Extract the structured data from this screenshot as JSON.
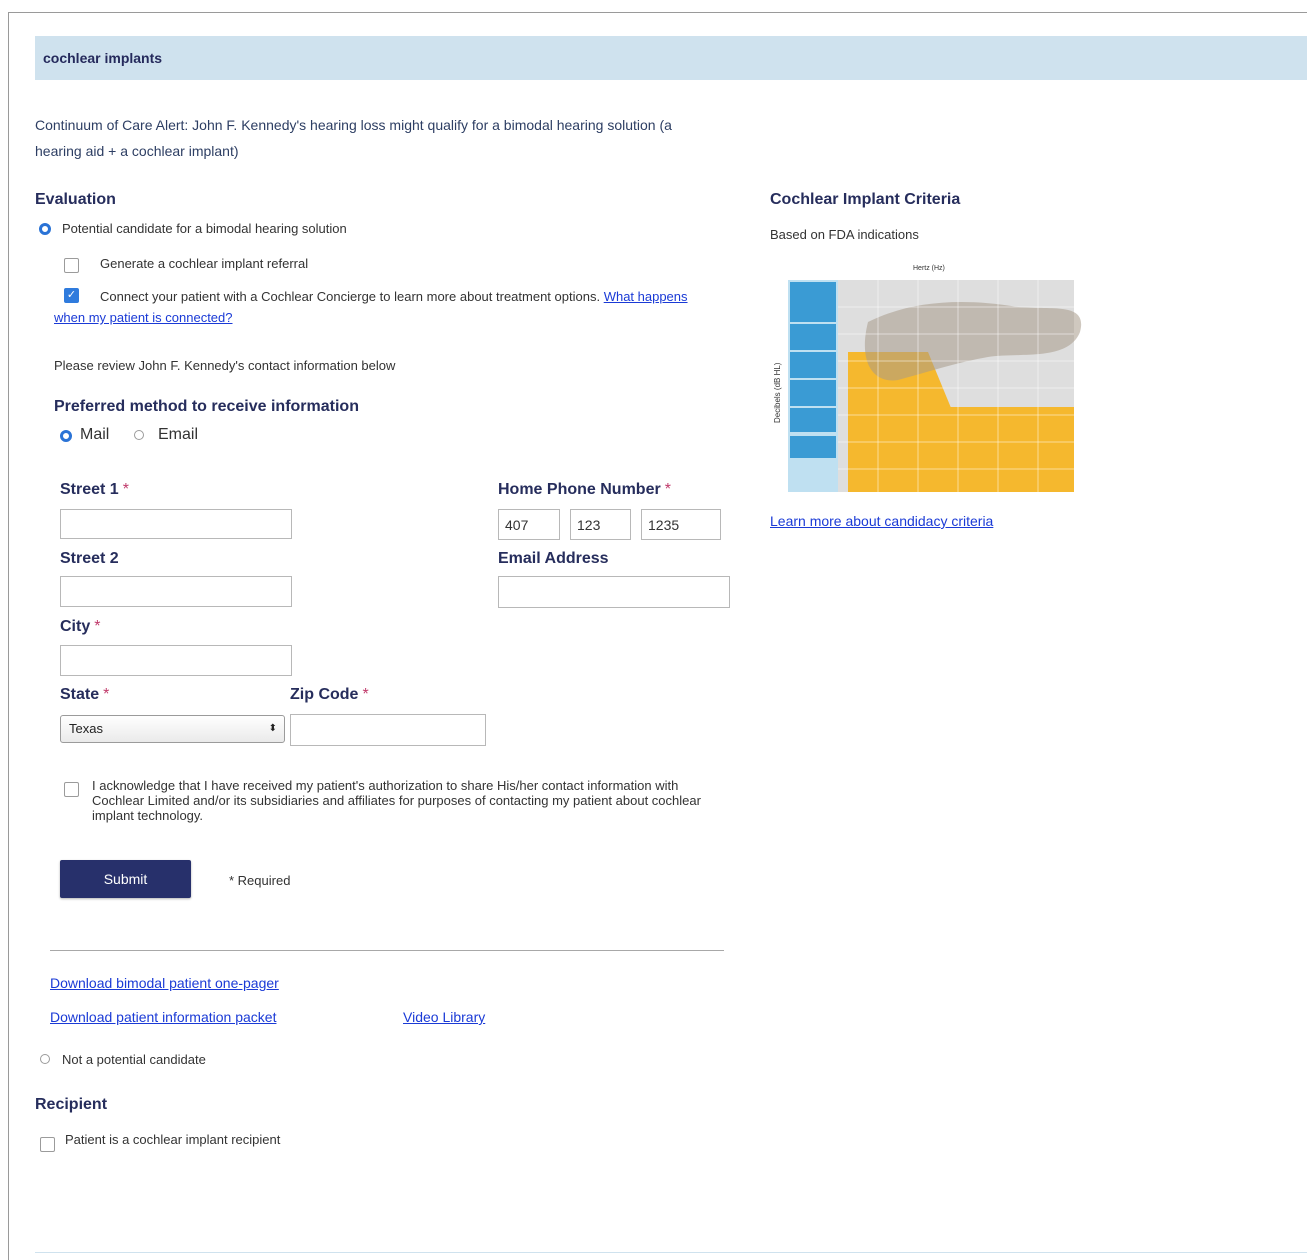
{
  "section": {
    "title": "cochlear implants"
  },
  "alert": {
    "text": "Continuum of Care Alert: John F. Kennedy's hearing loss might qualify for a bimodal hearing solution (a hearing aid + a cochlear implant)"
  },
  "evaluation": {
    "heading": "Evaluation",
    "option_candidate": "Potential candidate for a bimodal hearing solution",
    "generate_referral": "Generate a cochlear implant referral",
    "connect_concierge": "Connect your patient with a Cochlear Concierge to learn more about treatment options.",
    "connect_link": "What happens when my patient is connected?",
    "review_text": "Please review John F. Kennedy's contact information below",
    "preferred_heading": "Preferred method to receive information",
    "method_mail": "Mail",
    "method_email": "Email",
    "option_not_candidate": "Not a potential candidate"
  },
  "form": {
    "street1_label": "Street 1",
    "street2_label": "Street 2",
    "city_label": "City",
    "state_label": "State",
    "state_value": "Texas",
    "zip_label": "Zip Code",
    "phone_label": "Home Phone Number",
    "phone_area": "407",
    "phone_prefix": "123",
    "phone_line": "1235",
    "email_label": "Email Address",
    "required_mark": "*",
    "acknowledge": "I acknowledge that I have received my patient's authorization to share His/her contact information with Cochlear Limited and/or its subsidiaries and affiliates for purposes of contacting my patient about cochlear implant technology.",
    "submit_label": "Submit",
    "required_note": "* Required"
  },
  "links": {
    "download_onepager": "Download bimodal patient one-pager",
    "download_packet": "Download patient information packet",
    "video_library": "Video Library"
  },
  "recipient": {
    "heading": "Recipient",
    "checkbox_label": "Patient is a cochlear implant recipient"
  },
  "criteria": {
    "heading": "Cochlear Implant Criteria",
    "subtitle": "Based on FDA indications",
    "chart_xlabel": "Hertz (Hz)",
    "chart_ylabel": "Decibels (dB HL)",
    "learn_more": "Learn more about candidacy criteria"
  },
  "colors": {
    "header_bg": "#cfe2ee",
    "heading": "#262d5c",
    "link": "#1a3ad6",
    "button": "#27306b",
    "checked": "#2f7bdd",
    "chart_yellow": "#f5b82e",
    "chart_blue": "#3a9bd4"
  }
}
